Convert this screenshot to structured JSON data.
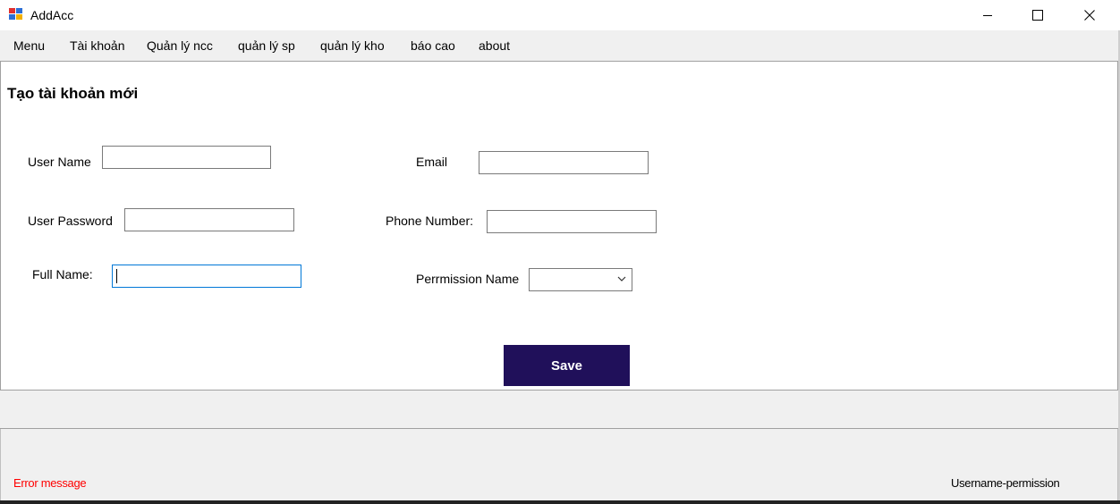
{
  "window": {
    "title": "AddAcc"
  },
  "menu": {
    "items": [
      "Menu",
      "Tài khoản",
      "Quản lý ncc",
      "quản lý sp",
      "quản lý kho",
      "báo cao",
      "about"
    ]
  },
  "form": {
    "heading": "Tạo tài khoản mới",
    "username_label": "User Name",
    "username_value": "",
    "password_label": "User Password",
    "password_value": "",
    "fullname_label": "Full Name:",
    "fullname_value": "",
    "email_label": "Email",
    "email_value": "",
    "phone_label": "Phone Number:",
    "phone_value": "",
    "permission_label": "Perrmission Name",
    "permission_selected": "",
    "save_label": "Save"
  },
  "status": {
    "error_message": "Error message",
    "user_permission": "Username-permission"
  },
  "colors": {
    "save_button": "#20105a",
    "error_text": "#ff0000",
    "focus_border": "#0078d7"
  },
  "icons": {
    "app": "app-window-icon",
    "minimize": "minimize-icon",
    "maximize": "maximize-icon",
    "close": "close-icon",
    "dropdown": "chevron-down-icon"
  }
}
